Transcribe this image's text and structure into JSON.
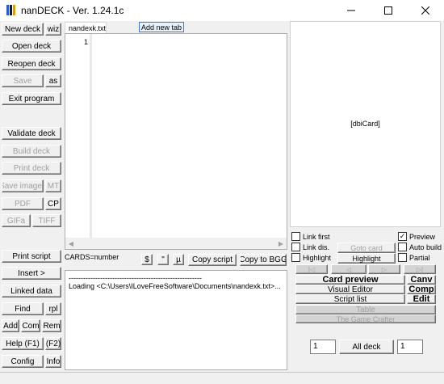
{
  "window": {
    "title": "nanDECK - Ver. 1.24.1c",
    "minimize_icon": "minimize-icon",
    "maximize_icon": "maximize-icon",
    "close_icon": "close-icon"
  },
  "left_toolbar": {
    "new_deck": "New deck",
    "wiz": "wiz",
    "open_deck": "Open deck",
    "reopen_deck": "Reopen deck",
    "save": "Save",
    "as": "as",
    "exit_program": "Exit program",
    "validate_deck": "Validate deck",
    "build_deck": "Build deck",
    "print_deck": "Print deck",
    "save_images": "Save images",
    "mt": "MT",
    "pdf": "PDF",
    "cp": "CP",
    "gifa": "GIFa",
    "tiff": "TIFF",
    "print_script": "Print script",
    "insert": "Insert >",
    "linked_data": "Linked data",
    "find": "Find",
    "rpl": "rpl",
    "add": "Add",
    "com": "Com",
    "rem": "Rem",
    "help": "Help (F1)",
    "f2": "(F2)",
    "config": "Config",
    "info": "Info"
  },
  "editor": {
    "tab_label": "nandexk.txt",
    "add_tab": "Add new tab",
    "line_number": "1",
    "cards_label": "CARDS=number",
    "btn_dollar": "$",
    "btn_quote": "\"",
    "btn_mu": "µ",
    "copy_script": "Copy script",
    "copy_to_bgg": "Copy to BGG"
  },
  "output": {
    "lines": [
      "-------------------------------------------------------",
      "Loading <C:\\Users\\ILoveFreeSoftware\\Documents\\nandexk.txt>..."
    ]
  },
  "preview": {
    "label": "[dbiCard]",
    "link_first": "Link first",
    "preview": "Preview",
    "link_dis": "Link dis.",
    "goto_card": "Goto card",
    "auto_build": "Auto build",
    "highlight_check": "Highlight",
    "highlight_btn": "Highlight",
    "partial": "Partial",
    "checked": {
      "link_first": false,
      "preview": true,
      "link_dis": false,
      "auto_build": false,
      "highlight": false,
      "partial": false
    },
    "nav_first": "|◁",
    "nav_prev": "◁",
    "nav_next": "▷",
    "nav_last": "▷|",
    "card_preview": "Card preview",
    "canv": "Canv",
    "visual_editor": "Visual Editor",
    "comp": "Comp",
    "script_list": "Script list",
    "edit": "Edit",
    "table": "Table",
    "game_crafter": "The Game Crafter",
    "from_value": "1",
    "all_deck": "All deck",
    "to_value": "1"
  }
}
